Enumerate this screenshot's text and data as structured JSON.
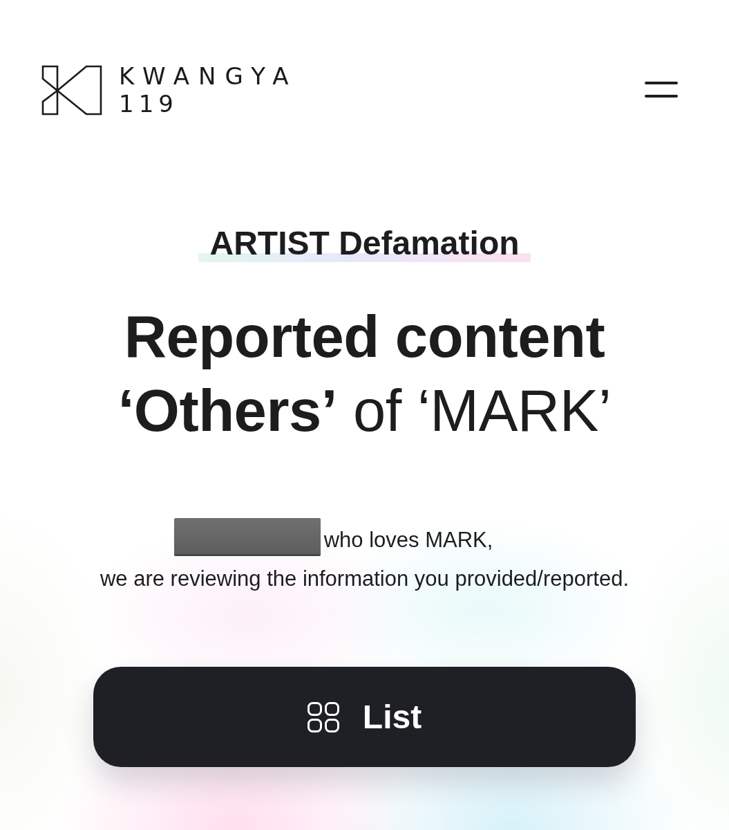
{
  "header": {
    "logo": {
      "line_1": "KWANGYA",
      "line_2": "119"
    }
  },
  "category": "ARTIST Defamation",
  "title": "**Reported content**\n**‘Others’** of ‘MARK’",
  "greeting": "who loves MARK,",
  "message": "we are reviewing the information you provided/reported.",
  "button": {
    "label": "List"
  }
}
